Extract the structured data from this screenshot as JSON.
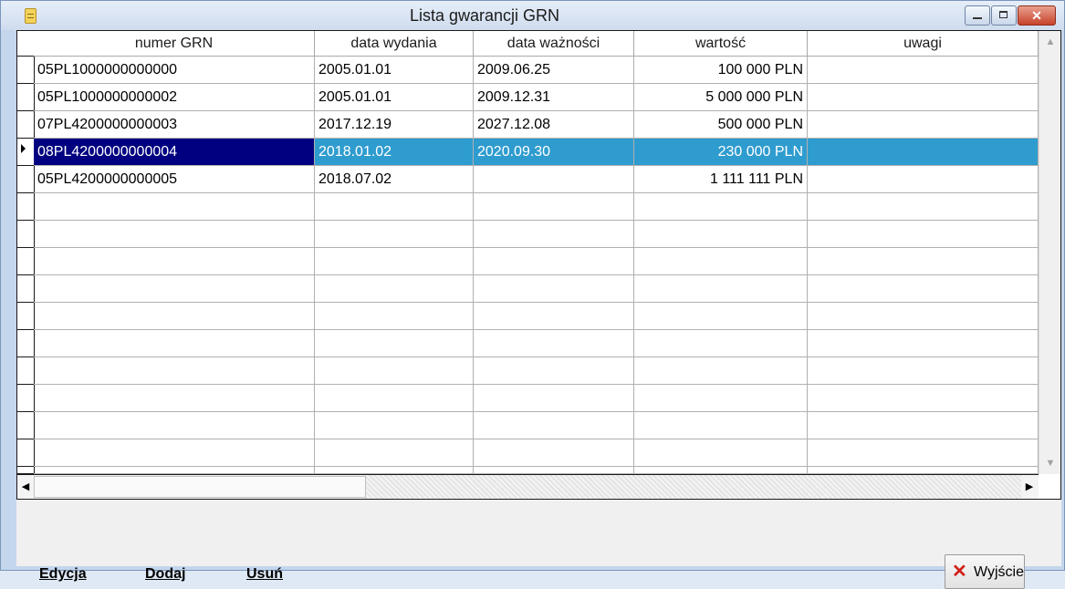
{
  "window": {
    "title": "Lista gwarancji GRN",
    "buttons": {
      "minimize": "—",
      "maximize": "□",
      "close": "✕"
    }
  },
  "grid": {
    "columns": [
      "numer GRN",
      "data wydania",
      "data ważności",
      "wartość",
      "uwagi"
    ],
    "rows": [
      [
        "05PL1000000000000",
        "2005.01.01",
        "2009.06.25",
        "100 000 PLN",
        ""
      ],
      [
        "05PL1000000000002",
        "2005.01.01",
        "2009.12.31",
        "5 000 000 PLN",
        ""
      ],
      [
        "07PL4200000000003",
        "2017.12.19",
        "2027.12.08",
        "500 000 PLN",
        ""
      ],
      [
        "08PL4200000000004",
        "2018.01.02",
        "2020.09.30",
        "230 000 PLN",
        ""
      ],
      [
        "05PL4200000000005",
        "2018.07.02",
        "",
        "1 111 111 PLN",
        ""
      ]
    ],
    "selected_row": 3
  },
  "actions": {
    "edit": "Edycja",
    "add": "Dodaj",
    "delete": "Usuń"
  },
  "exit_button": {
    "label": "Wyjście"
  },
  "colors": {
    "selection": "#2f9ccf",
    "selection_first_cell": "#000080",
    "exit_icon": "#d0201a"
  }
}
